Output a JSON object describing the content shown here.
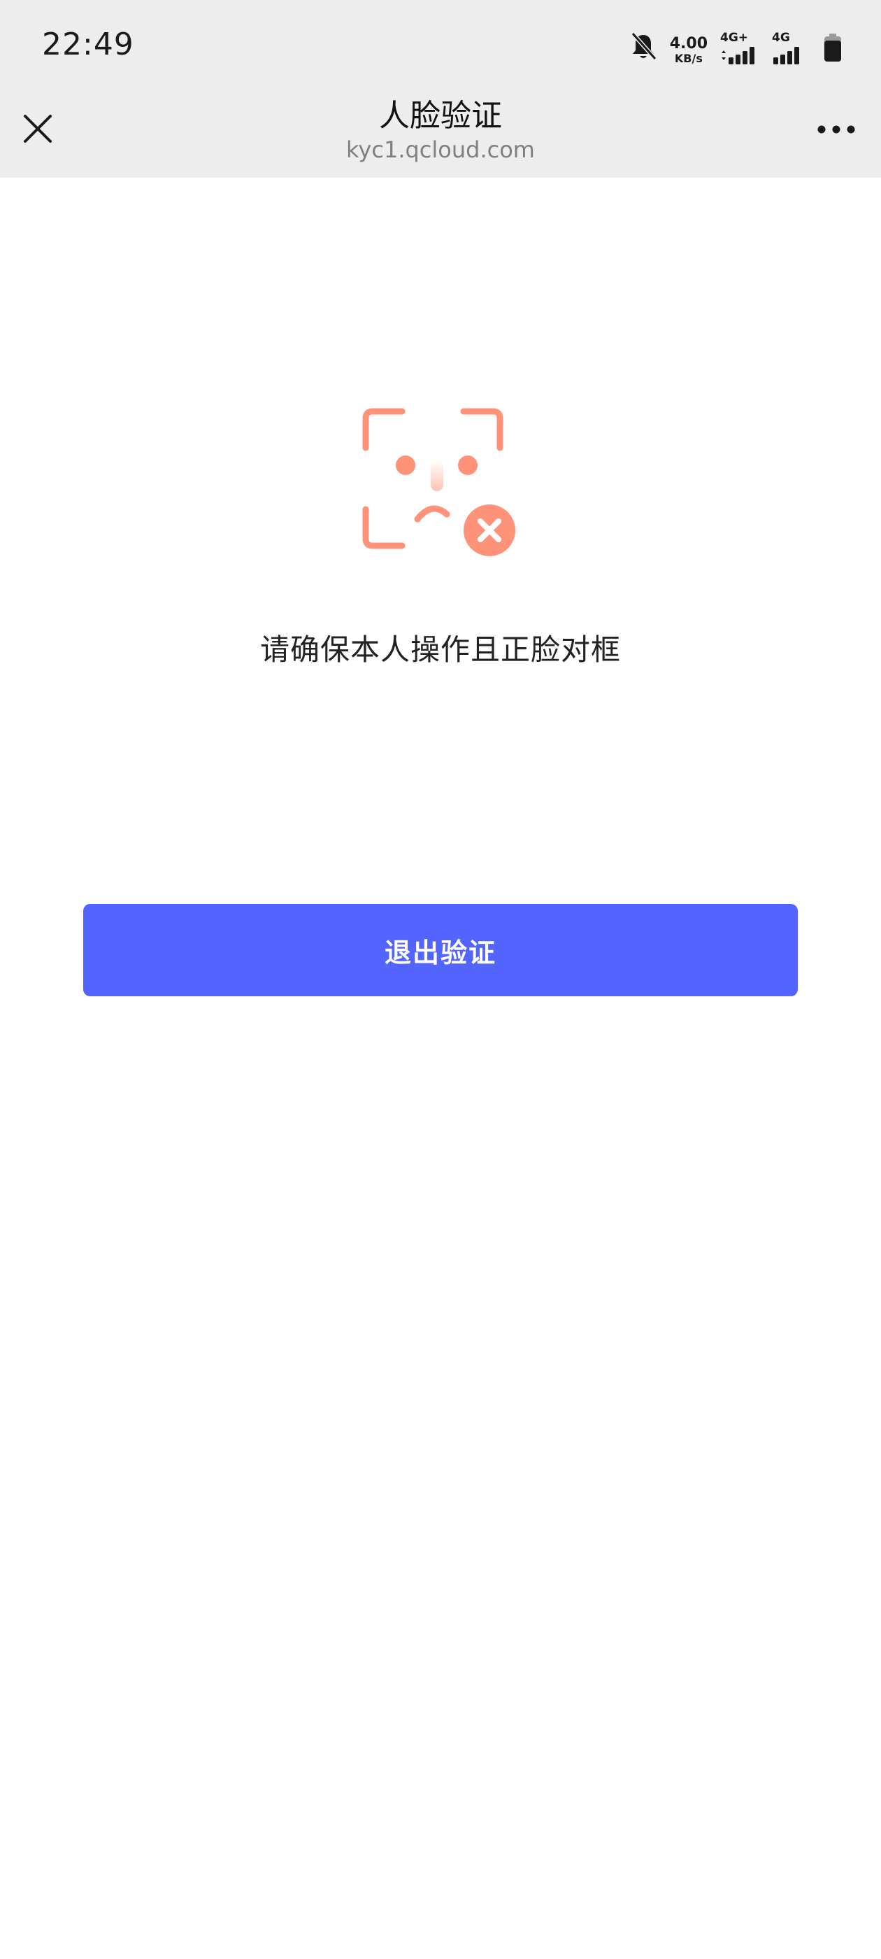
{
  "status_bar": {
    "time": "22:49",
    "net_speed_value": "4.00",
    "net_speed_unit": "KB/s",
    "signal_1_label": "4G+",
    "signal_2_label": "4G"
  },
  "title_bar": {
    "title": "人脸验证",
    "url": "kyc1.qcloud.com"
  },
  "main": {
    "prompt": "请确保本人操作且正脸对框",
    "exit_button_label": "退出验证"
  },
  "colors": {
    "accent": "#5464ff",
    "illustration": "#ff937a",
    "bar_bg": "#ededed"
  },
  "icons": {
    "close": "close-icon",
    "more": "more-icon",
    "face_error": "face-error-icon"
  }
}
